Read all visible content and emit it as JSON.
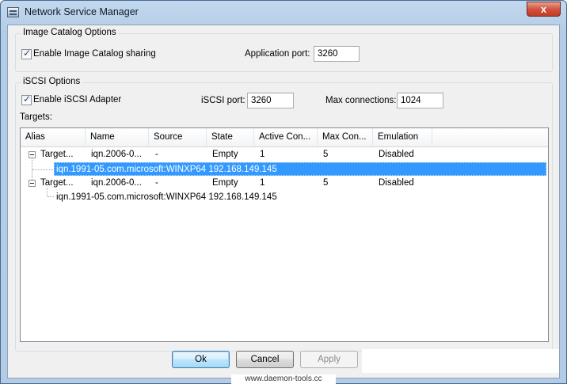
{
  "window": {
    "title": "Network Service Manager",
    "close_label": "x"
  },
  "image_catalog": {
    "legend": "Image Catalog Options",
    "enable_label": "Enable Image Catalog sharing",
    "enable_checked": true,
    "port_label": "Application port:",
    "port_value": "3260"
  },
  "iscsi": {
    "legend": "iSCSI Options",
    "enable_label": "Enable iSCSI Adapter",
    "enable_checked": true,
    "port_label": "iSCSI port:",
    "port_value": "3260",
    "maxconn_label": "Max connections:",
    "maxconn_value": "1024",
    "targets_label": "Targets:"
  },
  "targets": {
    "columns": [
      "Alias",
      "Name",
      "Source",
      "State",
      "Active Con...",
      "Max Con...",
      "Emulation"
    ],
    "rows": [
      {
        "alias": "Target...",
        "name": "iqn.2006-0...",
        "source": "-",
        "state": "Empty",
        "active": "1",
        "max": "5",
        "emulation": "Disabled",
        "child": "iqn.1991-05.com.microsoft:WINXP64 192.168.149.145",
        "child_selected": true
      },
      {
        "alias": "Target...",
        "name": "iqn.2006-0...",
        "source": "-",
        "state": "Empty",
        "active": "1",
        "max": "5",
        "emulation": "Disabled",
        "child": "iqn.1991-05.com.microsoft:WINXP64 192.168.149.145",
        "child_selected": false
      }
    ]
  },
  "buttons": {
    "ok": "Ok",
    "cancel": "Cancel",
    "apply": "Apply"
  },
  "watermark": "www.daemon-tools.cc"
}
